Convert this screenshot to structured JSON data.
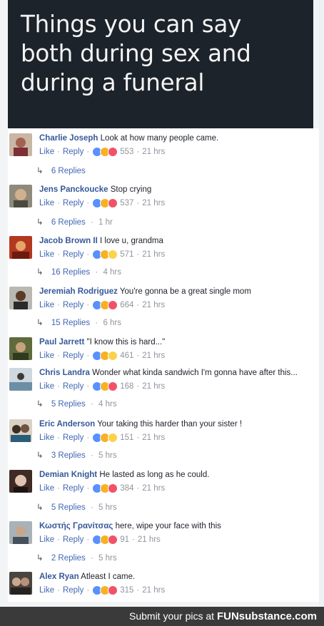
{
  "post": {
    "title": "Things you can say\nboth during sex and\nduring a funeral"
  },
  "labels": {
    "like": "Like",
    "reply": "Reply"
  },
  "colors": {
    "link": "#4267b2",
    "author": "#365899",
    "like": "#5890ff",
    "haha": "#f7b125",
    "love": "#f25268"
  },
  "comments": [
    {
      "author": "Charlie Joseph",
      "text": "Look at how many people came.",
      "reactions": [
        "like-icon",
        "haha-icon",
        "love-icon"
      ],
      "count": "553",
      "time": "21 hrs",
      "replies": "6 Replies",
      "replies_time": ""
    },
    {
      "author": "Jens Panckoucke",
      "text": "Stop crying",
      "reactions": [
        "like-icon",
        "haha-icon",
        "love-icon"
      ],
      "count": "537",
      "time": "21 hrs",
      "replies": "6 Replies",
      "replies_time": "1 hr"
    },
    {
      "author": "Jacob Brown II",
      "text": "I love u, grandma",
      "reactions": [
        "like-icon",
        "haha-icon",
        "wow-icon"
      ],
      "count": "571",
      "time": "21 hrs",
      "replies": "16 Replies",
      "replies_time": "4 hrs"
    },
    {
      "author": "Jeremiah Rodriguez",
      "text": "You're gonna be a great single mom",
      "reactions": [
        "like-icon",
        "haha-icon",
        "love-icon"
      ],
      "count": "664",
      "time": "21 hrs",
      "replies": "15 Replies",
      "replies_time": "6 hrs"
    },
    {
      "author": "Paul Jarrett",
      "text": "\"I know this is hard...\"",
      "reactions": [
        "like-icon",
        "haha-icon",
        "wow-icon"
      ],
      "count": "461",
      "time": "21 hrs",
      "replies": "",
      "replies_time": ""
    },
    {
      "author": "Chris Landra",
      "text": "Wonder what kinda sandwich I'm gonna have after this...",
      "reactions": [
        "like-icon",
        "haha-icon",
        "love-icon"
      ],
      "count": "168",
      "time": "21 hrs",
      "replies": "5 Replies",
      "replies_time": "4 hrs"
    },
    {
      "author": "Eric Anderson",
      "text": "Your taking this harder than your sister !",
      "reactions": [
        "like-icon",
        "haha-icon",
        "wow-icon"
      ],
      "count": "151",
      "time": "21 hrs",
      "replies": "3 Replies",
      "replies_time": "5 hrs"
    },
    {
      "author": "Demian Knight",
      "text": "He lasted as long as he could.",
      "reactions": [
        "like-icon",
        "haha-icon",
        "love-icon"
      ],
      "count": "384",
      "time": "21 hrs",
      "replies": "5 Replies",
      "replies_time": "5 hrs"
    },
    {
      "author": "Κωστής Γρανίτσας",
      "text": "here, wipe your face with this",
      "reactions": [
        "like-icon",
        "haha-icon",
        "love-icon"
      ],
      "count": "91",
      "time": "21 hrs",
      "replies": "2 Replies",
      "replies_time": "5 hrs"
    },
    {
      "author": "Alex Ryan",
      "text": "Atleast I came.",
      "reactions": [
        "like-icon",
        "haha-icon",
        "love-icon"
      ],
      "count": "315",
      "time": "21 hrs",
      "replies": "",
      "replies_time": ""
    }
  ],
  "footer": {
    "text": "Submit your pics at",
    "brand": "FUNsubstance.com"
  }
}
